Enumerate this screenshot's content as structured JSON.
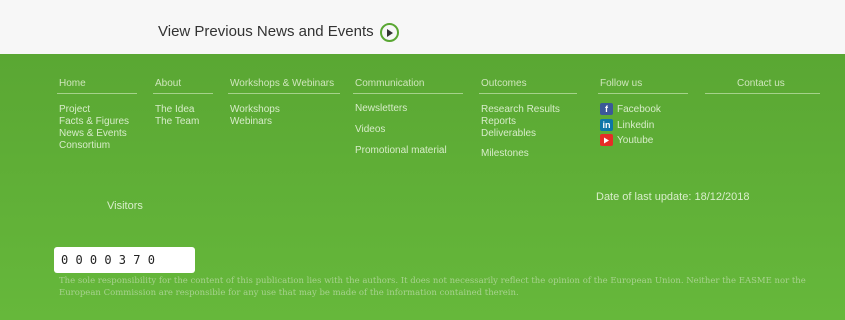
{
  "top": {
    "previous_link": "View Previous News and Events",
    "arrow_icon": "arrow-right-icon"
  },
  "nav": {
    "home": {
      "heading": "Home",
      "items": [
        "Project",
        "Facts & Figures",
        "News & Events",
        "Consortium"
      ]
    },
    "about": {
      "heading": "About",
      "items": [
        "The Idea",
        "The Team"
      ]
    },
    "workshops": {
      "heading": "Workshops & Webinars",
      "items": [
        "Workshops",
        "Webinars"
      ]
    },
    "communication": {
      "heading": "Communication",
      "items": [
        "Newsletters",
        "Videos",
        "Promotional material"
      ]
    },
    "outcomes": {
      "heading": "Outcomes",
      "items": [
        "Research Results",
        "Reports",
        "Deliverables",
        "Milestones"
      ]
    },
    "follow": {
      "heading": "Follow us",
      "items": [
        "Facebook",
        "Linkedin",
        "Youtube"
      ]
    },
    "contact": {
      "heading": "Contact us"
    }
  },
  "stats": {
    "visitors_label": "Visitors",
    "counter": "0 0 0 0 3 7 0",
    "last_update": "Date of last update: 18/12/2018"
  },
  "disclaimer": "The sole responsibility for the content of this publication lies with the authors. It does not necessarily reflect the opinion of the European Union. Neither the EASME nor the European Commission are responsible for any use that may be made of the information contained therein.",
  "colors": {
    "green": "#5aa733",
    "facebook": "#3b5998",
    "linkedin": "#0e76a8",
    "youtube": "#e52d27"
  }
}
